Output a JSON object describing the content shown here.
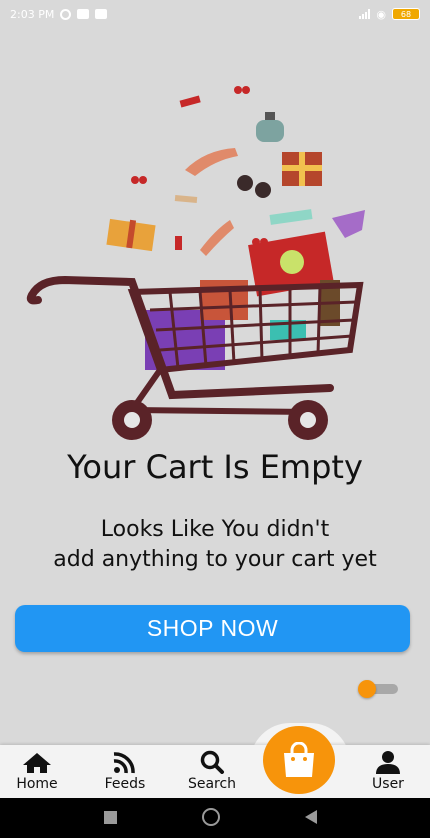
{
  "status_bar": {
    "time": "2:03 PM",
    "battery": "68"
  },
  "empty_state": {
    "title": "Your Cart Is Empty",
    "subtitle_line1": "Looks Like You didn't",
    "subtitle_line2": "add anything to your cart yet"
  },
  "shop_button": {
    "label": "SHOP NOW",
    "color": "#2196f3"
  },
  "bottom_nav": {
    "items": [
      {
        "label": "Home",
        "icon": "home-icon"
      },
      {
        "label": "Feeds",
        "icon": "rss-icon"
      },
      {
        "label": "Search",
        "icon": "search-icon"
      },
      {
        "label": "User",
        "icon": "user-icon"
      }
    ],
    "cart_icon": "shopping-bag-icon",
    "accent": "#f7940b"
  }
}
